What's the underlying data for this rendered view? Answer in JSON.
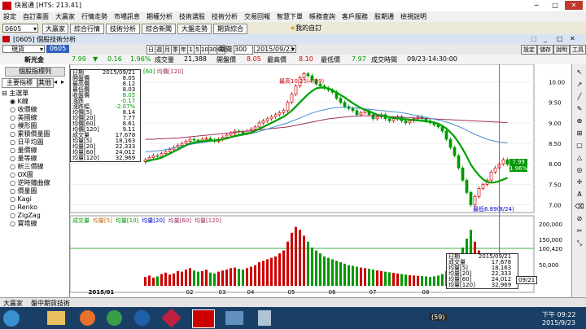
{
  "window": {
    "title": "快易通 [HTS: 213.41]"
  },
  "menu": [
    "設定",
    "自訂畫面",
    "大贏家",
    "行情走勢",
    "市場訊息",
    "期權分析",
    "技術選股",
    "技術分析",
    "交易回報",
    "智慧下單",
    "帳務查詢",
    "客戶服務",
    "股期通",
    "檢視說明"
  ],
  "toolbar": {
    "code": "0605",
    "buttons": [
      "大贏家",
      "綜合行情",
      "技術分析",
      "綜合新聞",
      "大盤走勢",
      "期貨綜合"
    ],
    "my_favorite": "我的自訂"
  },
  "panel": {
    "title": "[0605] 個股技術分析",
    "right_buttons": [
      "設定",
      "儲存",
      "說明",
      "工具"
    ]
  },
  "subbar": {
    "period_select": "現貨",
    "stock_code": "0605",
    "freq_buttons": [
      "日",
      "週",
      "月",
      "季",
      "年",
      "1",
      "5",
      "10",
      "30",
      "60"
    ],
    "period_label": "期間",
    "period_value": "300",
    "date_value": "2015/09/23"
  },
  "quote": {
    "name": "新光金",
    "price": "7.99",
    "change": "0.16",
    "change_pct": "1.96%",
    "volume_label": "成交量",
    "volume": "21,388",
    "open_label": "開盤價",
    "open": "8.05",
    "high_label": "最高價",
    "high": "8.10",
    "low_label": "最低價",
    "low": "7.97",
    "time_label": "成交時間",
    "time": "09/23-14:30:00"
  },
  "left_panel": {
    "tab1": "主要指標",
    "tab2": "其他",
    "header": "個股指標列",
    "tree": [
      "主選單",
      "K線",
      "收價線",
      "美國線",
      "樸形圖",
      "累積價量圖",
      "日平均圖",
      "量價線",
      "量等線",
      "新三價線",
      "OX圖",
      "逆時鐘曲線",
      "價量圖",
      "Kagi",
      "Renko",
      "ZigZag",
      "寶塔線"
    ]
  },
  "chart_data": {
    "type": "candlestick",
    "x_month_labels": [
      "2015/01",
      "02",
      "03",
      "04",
      "05",
      "06",
      "07",
      "08"
    ],
    "price_axis": [
      10.0,
      9.5,
      9.0,
      8.5,
      8.0,
      7.5,
      7.0
    ],
    "ylim": [
      6.85,
      10.35
    ],
    "annotations": {
      "high": "最高10.25(4/29)",
      "low": "最低6.89(8/24)"
    },
    "price_legend": [
      "[60]",
      "均價[120]"
    ],
    "current_price_tag": "7.99",
    "current_pct_tag": "1.96%",
    "volume_legend": [
      "成交量",
      "均量[5]",
      "均量[10]",
      "均量[20]",
      "均量[60]",
      "均量[120]"
    ],
    "volume_axis": [
      "200,000",
      "150,000",
      "100,420",
      "50,000"
    ],
    "closes": [
      8.1,
      8.15,
      8.2,
      8.18,
      8.25,
      8.3,
      8.35,
      8.4,
      8.45,
      8.5,
      8.55,
      8.6,
      8.58,
      8.55,
      8.6,
      8.62,
      8.58,
      8.55,
      8.6,
      8.65,
      8.7,
      8.75,
      8.8,
      8.78,
      8.75,
      8.8,
      8.85,
      8.9,
      9.0,
      9.05,
      9.1,
      9.15,
      9.2,
      9.25,
      9.3,
      9.5,
      9.7,
      9.9,
      10.1,
      10.2,
      10.15,
      10.05,
      9.95,
      9.9,
      9.85,
      9.8,
      9.75,
      9.6,
      9.5,
      9.4,
      9.35,
      9.3,
      9.2,
      9.25,
      9.3,
      9.2,
      9.1,
      9.15,
      9.2,
      9.1,
      9.05,
      9.1,
      9.15,
      9.05,
      9.0,
      9.05,
      9.1,
      9.15,
      9.1,
      9.05,
      9.0,
      8.95,
      8.9,
      8.8,
      8.6,
      8.4,
      8.2,
      7.9,
      7.6,
      7.3,
      7.0,
      7.2,
      7.4,
      7.5,
      7.6,
      7.8,
      7.9,
      8.0,
      8.1,
      7.99
    ],
    "ma20": [
      8.05,
      8.08,
      8.1,
      8.12,
      8.15,
      8.2,
      8.25,
      8.3,
      8.35,
      8.4,
      8.45,
      8.5,
      8.52,
      8.54,
      8.55,
      8.56,
      8.57,
      8.57,
      8.58,
      8.6,
      8.62,
      8.65,
      8.68,
      8.7,
      8.72,
      8.74,
      8.76,
      8.8,
      8.85,
      8.9,
      8.95,
      9.0,
      9.05,
      9.1,
      9.15,
      9.22,
      9.3,
      9.4,
      9.5,
      9.6,
      9.7,
      9.78,
      9.84,
      9.86,
      9.86,
      9.84,
      9.8,
      9.74,
      9.68,
      9.62,
      9.55,
      9.48,
      9.42,
      9.36,
      9.32,
      9.28,
      9.24,
      9.2,
      9.18,
      9.16,
      9.14,
      9.12,
      9.11,
      9.1,
      9.09,
      9.08,
      9.07,
      9.06,
      9.05,
      9.04,
      9.03,
      9.01,
      8.98,
      8.93,
      8.86,
      8.77,
      8.66,
      8.52,
      8.36,
      8.18,
      7.98,
      7.84,
      7.72,
      7.62,
      7.56,
      7.54,
      7.55,
      7.58,
      7.62,
      7.66
    ],
    "ma60": [
      8.3,
      8.3,
      8.31,
      8.32,
      8.33,
      8.35,
      8.37,
      8.39,
      8.41,
      8.43,
      8.45,
      8.47,
      8.49,
      8.5,
      8.52,
      8.53,
      8.55,
      8.56,
      8.58,
      8.6,
      8.62,
      8.64,
      8.66,
      8.68,
      8.7,
      8.72,
      8.74,
      8.76,
      8.79,
      8.82,
      8.85,
      8.88,
      8.91,
      8.94,
      8.97,
      9.0,
      9.04,
      9.08,
      9.12,
      9.16,
      9.2,
      9.24,
      9.27,
      9.3,
      9.32,
      9.34,
      9.36,
      9.37,
      9.38,
      9.38,
      9.38,
      9.37,
      9.36,
      9.35,
      9.34,
      9.33,
      9.32,
      9.31,
      9.3,
      9.29,
      9.28,
      9.27,
      9.26,
      9.25,
      9.23,
      9.21,
      9.19,
      9.17,
      9.15,
      9.13,
      9.11,
      9.09,
      9.07,
      9.05,
      9.02,
      8.99,
      8.95,
      8.91,
      8.87,
      8.82,
      8.77,
      8.72,
      8.68,
      8.64,
      8.6,
      8.57,
      8.55,
      8.53,
      8.52,
      8.51
    ],
    "ma120": [
      8.6,
      8.6,
      8.6,
      8.61,
      8.61,
      8.62,
      8.62,
      8.63,
      8.63,
      8.64,
      8.65,
      8.66,
      8.67,
      8.68,
      8.69,
      8.7,
      8.71,
      8.72,
      8.73,
      8.74,
      8.75,
      8.76,
      8.77,
      8.78,
      8.79,
      8.8,
      8.81,
      8.82,
      8.83,
      8.84,
      8.85,
      8.86,
      8.87,
      8.88,
      8.89,
      8.9,
      8.92,
      8.94,
      8.96,
      8.98,
      9.0,
      9.02,
      9.04,
      9.06,
      9.08,
      9.1,
      9.11,
      9.12,
      9.13,
      9.14,
      9.15,
      9.16,
      9.16,
      9.17,
      9.17,
      9.17,
      9.17,
      9.17,
      9.16,
      9.16,
      9.15,
      9.15,
      9.14,
      9.14,
      9.13,
      9.13,
      9.12,
      9.12,
      9.11,
      9.11,
      9.1,
      9.1,
      9.09,
      9.09,
      9.08,
      9.08,
      9.07,
      9.07,
      9.06,
      9.06,
      9.05,
      9.05,
      9.04,
      9.04,
      9.03,
      9.03,
      9.02,
      9.02,
      9.01,
      9.01
    ],
    "volumes": [
      30,
      35,
      28,
      32,
      40,
      45,
      38,
      42,
      50,
      48,
      55,
      60,
      52,
      48,
      50,
      55,
      45,
      42,
      48,
      52,
      55,
      60,
      62,
      58,
      55,
      60,
      65,
      70,
      80,
      85,
      90,
      95,
      100,
      110,
      120,
      150,
      180,
      200,
      190,
      170,
      150,
      130,
      120,
      110,
      100,
      95,
      90,
      85,
      80,
      75,
      70,
      68,
      65,
      62,
      60,
      58,
      55,
      52,
      50,
      48,
      46,
      44,
      42,
      40,
      38,
      36,
      35,
      34,
      33,
      32,
      30,
      32,
      35,
      40,
      50,
      65,
      80,
      100,
      130,
      160,
      190,
      150,
      120,
      100,
      85,
      75,
      68,
      62,
      58,
      55
    ]
  },
  "info_box_top": {
    "rows": [
      [
        "日期",
        "2015/09/21"
      ],
      [
        "開盤價",
        "8.05"
      ],
      [
        "最高價",
        "8.12"
      ],
      [
        "最低價",
        "8.03"
      ],
      [
        "收盤價",
        "8.05"
      ],
      [
        "漲跌",
        "-0.17"
      ],
      [
        "漲跌幅",
        "-2.07%"
      ],
      [
        "均價[5]",
        "8.14"
      ],
      [
        "均價[20]",
        "7.77"
      ],
      [
        "均價[60]",
        "8.61"
      ],
      [
        "均價[120]",
        "9.11"
      ],
      [
        "成交量",
        "17,678"
      ],
      [
        "均量[5]",
        "18,163"
      ],
      [
        "均量[20]",
        "22,333"
      ],
      [
        "均量[60]",
        "24,012"
      ],
      [
        "均量[120]",
        "32,969"
      ]
    ]
  },
  "info_box_vol": {
    "rows": [
      [
        "日期",
        "2015/09/21"
      ],
      [
        "成交量",
        "17,678"
      ],
      [
        "均量[5]",
        "18,163"
      ],
      [
        "均量[20]",
        "22,333"
      ],
      [
        "均量[60]",
        "24,012"
      ],
      [
        "均量[120]",
        "32,969"
      ]
    ],
    "date_tag": "09/21"
  },
  "status": {
    "left_tab1": "大贏家",
    "left_tab2": "盤中期貨技術"
  },
  "taskbar": {
    "time": "下午 09:22",
    "date": "2015/9/23",
    "tray_badge": "(59)"
  },
  "colors": {
    "up": "#cc0000",
    "down": "#009900",
    "ma20": "#00a000",
    "ma60": "#4a90d0",
    "ma120": "#a03060"
  }
}
